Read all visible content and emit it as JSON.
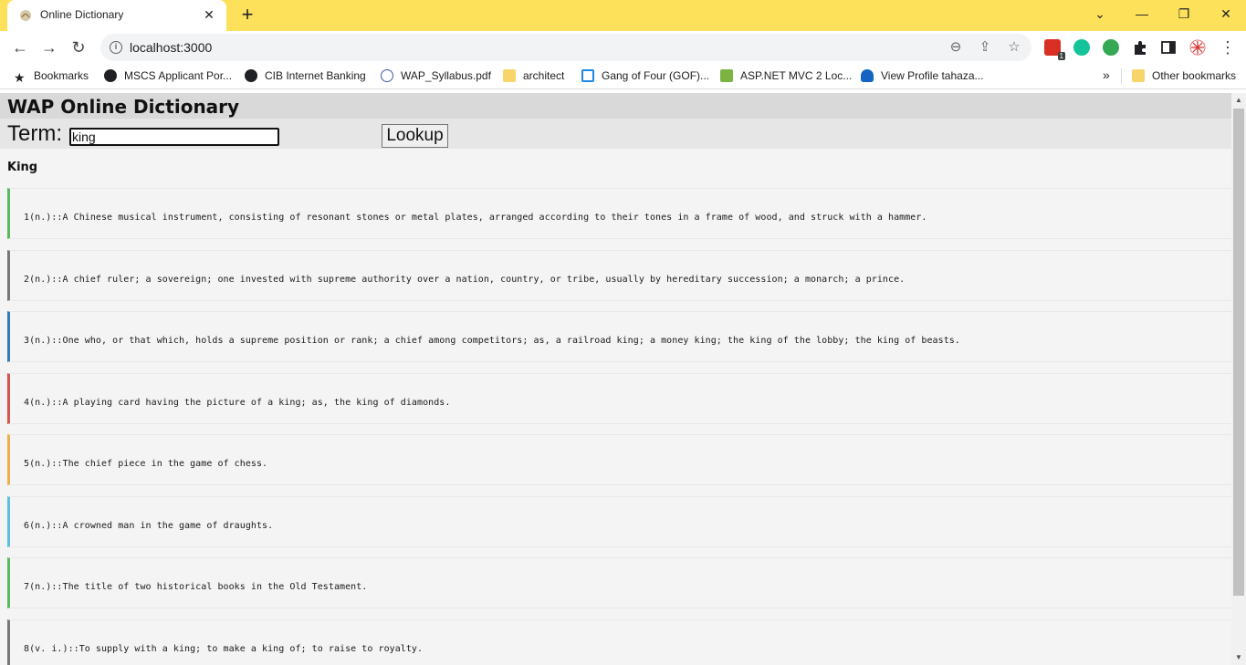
{
  "browser": {
    "tab": {
      "title": "Online Dictionary",
      "close_glyph": "✕"
    },
    "new_tab_glyph": "+",
    "window_controls": {
      "dropdown": "⌄",
      "minimize": "—",
      "restore": "❐",
      "close": "✕"
    },
    "nav": {
      "back": "←",
      "forward": "→",
      "reload": "↻"
    },
    "address": {
      "url": "localhost:3000",
      "info_glyph": "i"
    },
    "omnibox_icons": {
      "zoom": "⊖",
      "share": "⇪",
      "star": "☆"
    },
    "extensions_badge": "1",
    "bookmarks": [
      {
        "label": "Bookmarks",
        "icon": "star-icon",
        "color": "#202124"
      },
      {
        "label": "MSCS Applicant Por...",
        "icon": "globe-icon",
        "color": "#202124"
      },
      {
        "label": "CIB Internet Banking",
        "icon": "globe-icon",
        "color": "#202124"
      },
      {
        "label": "WAP_Syllabus.pdf",
        "icon": "seal-icon",
        "color": "#3b5bab"
      },
      {
        "label": "architect",
        "icon": "folder-icon",
        "color": "#f7d56b"
      },
      {
        "label": "Gang of Four (GOF)...",
        "icon": "d-logo-icon",
        "color": "#1e88e5"
      },
      {
        "label": "ASP.NET MVC 2 Loc...",
        "icon": "s-logo-icon",
        "color": "#7cb342"
      },
      {
        "label": "View Profile tahaza...",
        "icon": "butterfly-icon",
        "color": "#1565c0"
      }
    ],
    "bookmarks_overflow": "»",
    "other_bookmarks": "Other bookmarks"
  },
  "app": {
    "title": "WAP Online Dictionary",
    "term_label": "Term:",
    "term_value": "king",
    "lookup_label": "Lookup",
    "word": "King",
    "definitions": [
      {
        "text": "1(n.)::A Chinese musical instrument, consisting of resonant stones or metal plates, arranged according to their tones in a frame of wood, and struck with a hammer.",
        "accent": "#5cb85c"
      },
      {
        "text": "2(n.)::A chief ruler; a sovereign; one invested with supreme authority over a nation, country, or tribe, usually by hereditary succession; a monarch; a prince.",
        "accent": "#777777"
      },
      {
        "text": "3(n.)::One who, or that which, holds a supreme position or rank; a chief among competitors; as, a railroad king; a money king; the king of the lobby; the king of beasts.",
        "accent": "#337ab7"
      },
      {
        "text": "4(n.)::A playing card having the picture of a king; as, the king of diamonds.",
        "accent": "#d9534f"
      },
      {
        "text": "5(n.)::The chief piece in the game of chess.",
        "accent": "#f0ad4e"
      },
      {
        "text": "6(n.)::A crowned man in the game of draughts.",
        "accent": "#5bc0de"
      },
      {
        "text": "7(n.)::The title of two historical books in the Old Testament.",
        "accent": "#5cb85c"
      },
      {
        "text": "8(v. i.)::To supply with a king; to make a king of; to raise to royalty.",
        "accent": "#777777"
      }
    ]
  },
  "scrollbar": {
    "up": "▲",
    "down": "▼"
  }
}
